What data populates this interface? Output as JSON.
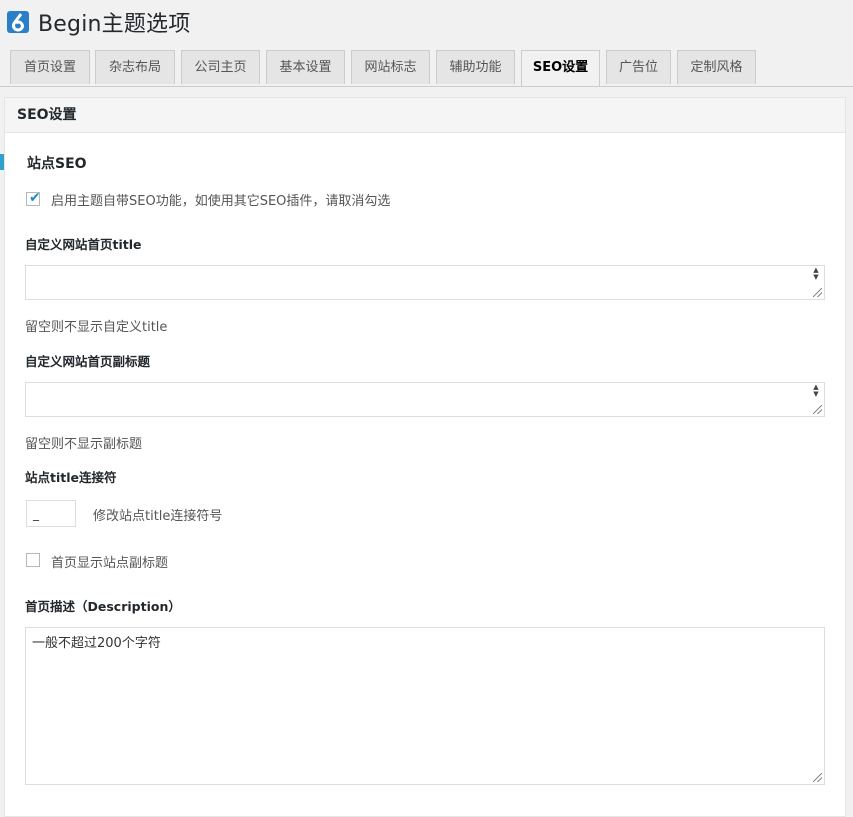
{
  "header": {
    "title": "Begin主题选项"
  },
  "tabs": [
    {
      "label": "首页设置",
      "active": false
    },
    {
      "label": "杂志布局",
      "active": false
    },
    {
      "label": "公司主页",
      "active": false
    },
    {
      "label": "基本设置",
      "active": false
    },
    {
      "label": "网站标志",
      "active": false
    },
    {
      "label": "辅助功能",
      "active": false
    },
    {
      "label": "SEO设置",
      "active": true
    },
    {
      "label": "广告位",
      "active": false
    },
    {
      "label": "定制风格",
      "active": false
    }
  ],
  "panel": {
    "heading": "SEO设置"
  },
  "section": {
    "title": "站点SEO"
  },
  "enable_seo": {
    "label": "启用主题自带SEO功能，如使用其它SEO插件，请取消勾选",
    "checked": true
  },
  "home_title": {
    "label": "自定义网站首页title",
    "value": "",
    "hint": "留空则不显示自定义title"
  },
  "home_subtitle": {
    "label": "自定义网站首页副标题",
    "value": "",
    "hint": "留空则不显示副标题"
  },
  "connector": {
    "label": "站点title连接符",
    "value": "_",
    "hint": "修改站点title连接符号"
  },
  "show_subtitle": {
    "label": "首页显示站点副标题",
    "checked": false
  },
  "description": {
    "label": "首页描述（Description）",
    "value": "一般不超过200个字符"
  },
  "colors": {
    "accent": "#2ea2cc",
    "check": "#1e8cbe",
    "logo": "#2b7fc9"
  }
}
